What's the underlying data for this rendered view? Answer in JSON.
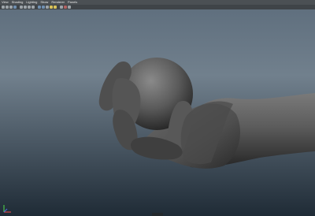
{
  "menubar": {
    "items": [
      "View",
      "Shading",
      "Lighting",
      "Show",
      "Renderer",
      "Panels"
    ]
  },
  "toolbar": {
    "icons": [
      "camera-icon",
      "select-camera-icon",
      "lock-camera-icon",
      "bookmark-icon",
      "image-plane-icon",
      "grid-icon",
      "film-gate-icon",
      "resolution-gate-icon",
      "wireframe-icon",
      "smooth-shade-icon",
      "textured-icon",
      "lights-icon",
      "shadows-icon",
      "xray-icon",
      "isolate-icon",
      "quality-icon"
    ]
  },
  "colors": {
    "background_top": "#5d6d7c",
    "background_bottom": "#1f2b36",
    "model": "#5a5a5a"
  },
  "scene": {
    "object": "grey-hand-holding-ball-model"
  }
}
